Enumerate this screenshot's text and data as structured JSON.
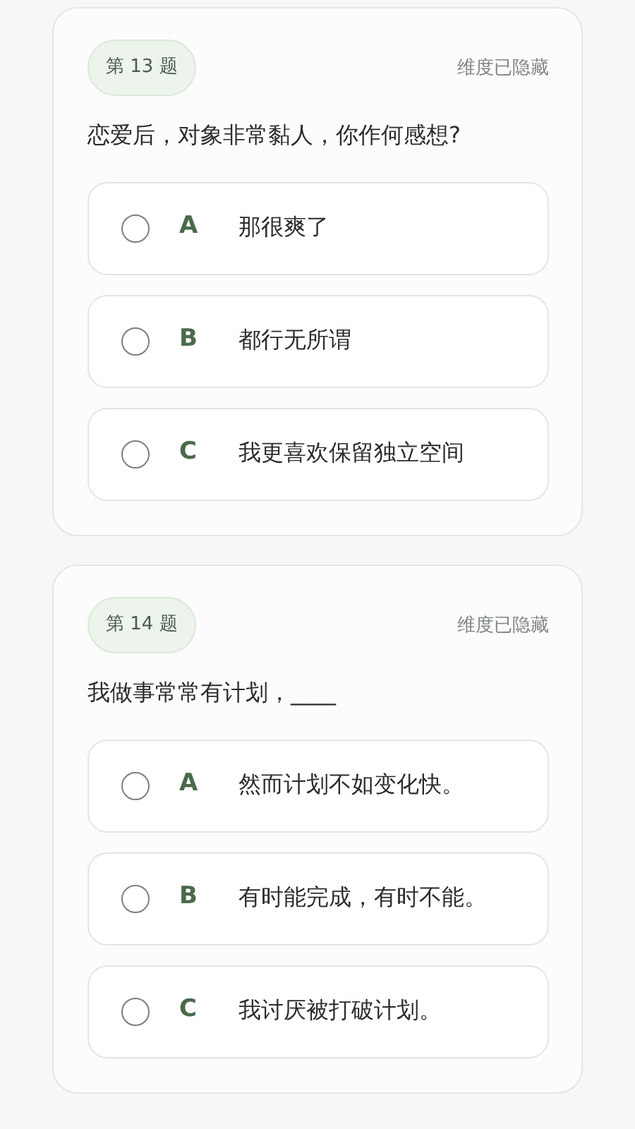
{
  "questions": [
    {
      "number": "第 13 题",
      "dimension": "维度已隐藏",
      "text": "恋爱后，对象非常黏人，你作何感想?",
      "options": [
        {
          "letter": "A",
          "text": "那很爽了",
          "selected": false
        },
        {
          "letter": "B",
          "text": "都行无所谓",
          "selected": false
        },
        {
          "letter": "C",
          "text": "我更喜欢保留独立空间",
          "selected": false
        }
      ]
    },
    {
      "number": "第 14 题",
      "dimension": "维度已隐藏",
      "text": "我做事常常有计划，____",
      "options": [
        {
          "letter": "A",
          "text": "然而计划不如变化快。",
          "selected": false
        },
        {
          "letter": "B",
          "text": "有时能完成，有时不能。",
          "selected": false
        },
        {
          "letter": "C",
          "text": "我讨厌被打破计划。",
          "selected": false
        }
      ]
    }
  ]
}
